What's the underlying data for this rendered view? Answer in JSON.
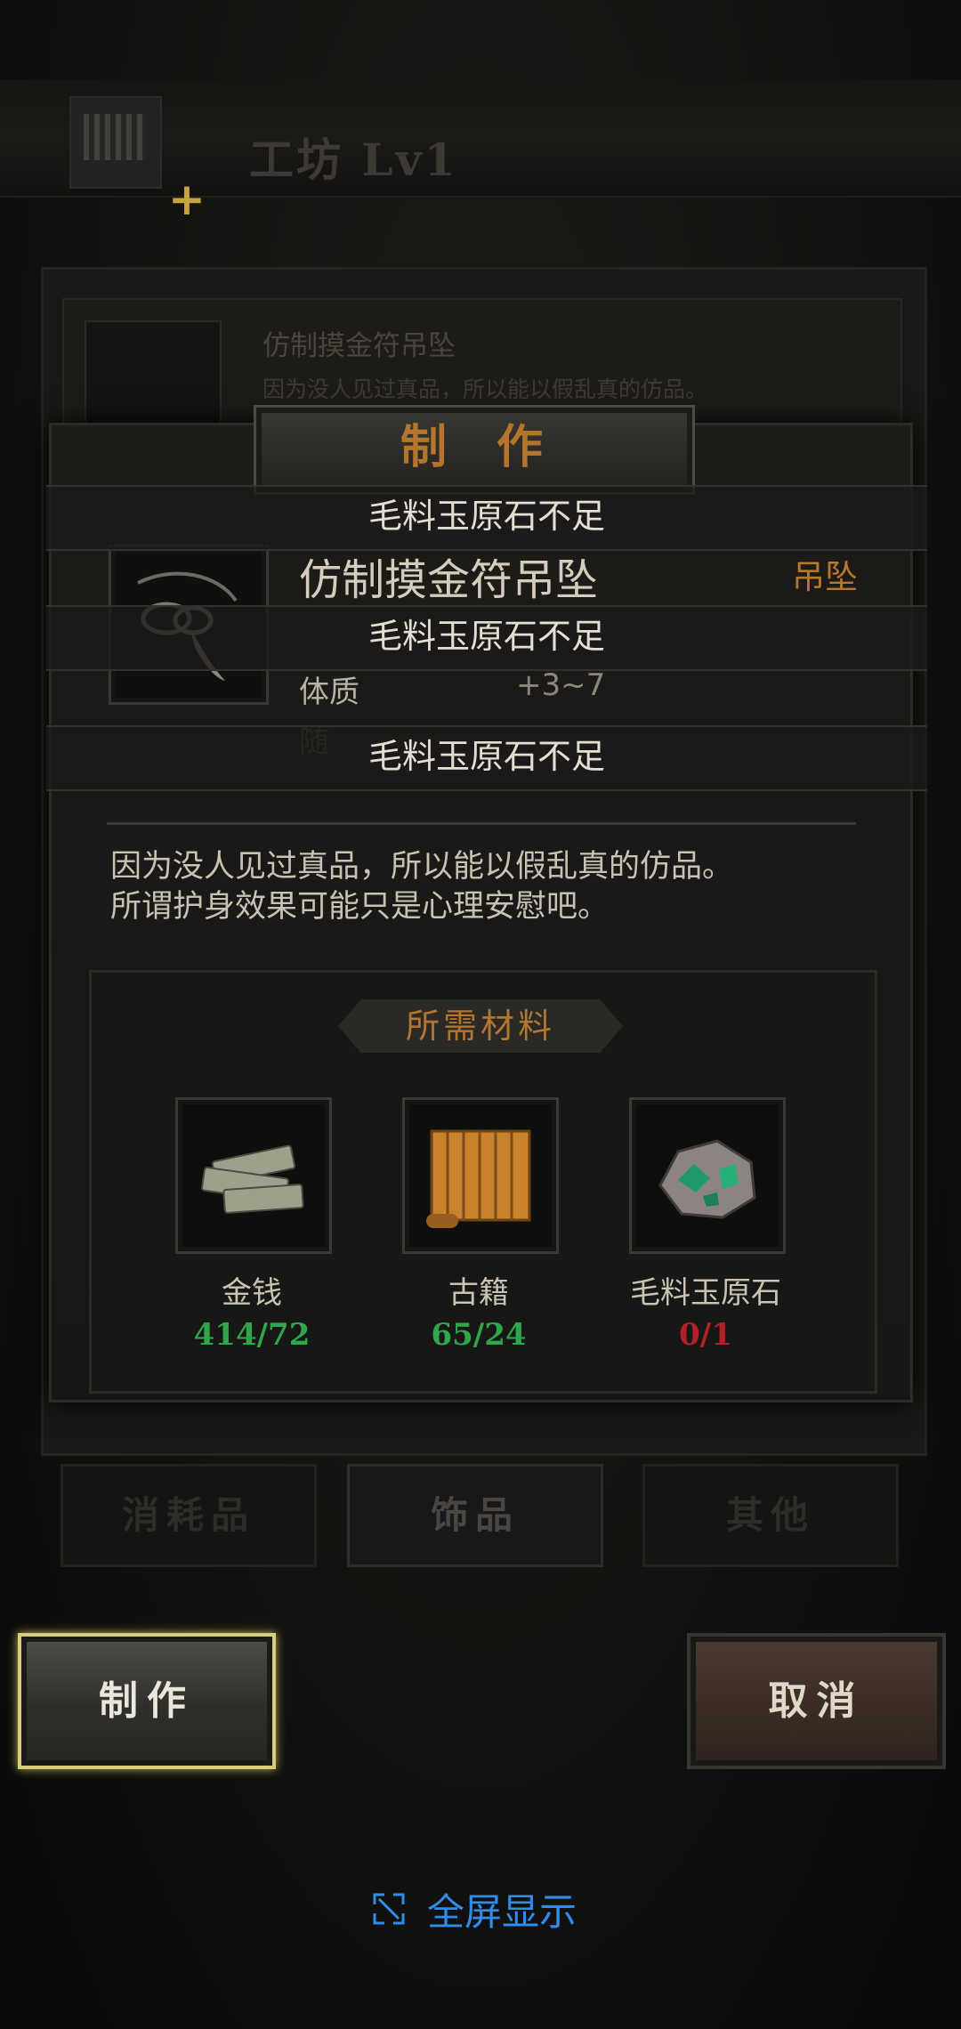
{
  "header": {
    "title": "工坊 Lv1"
  },
  "background_item": {
    "name": "仿制摸金符吊坠",
    "desc": "因为没人见过真品，所以能以假乱真的仿品。"
  },
  "tabs": [
    {
      "label": "消耗品"
    },
    {
      "label": "饰品"
    },
    {
      "label": "其他"
    }
  ],
  "dialog": {
    "title": "制作",
    "warnings": [
      "毛料玉原石不足",
      "毛料玉原石不足",
      "毛料玉原石不足"
    ],
    "item": {
      "name": "仿制摸金符吊坠",
      "type": "吊坠",
      "stat_label": "体质",
      "stat_value": "+3~7",
      "faded_label": "随"
    },
    "description": [
      "因为没人见过真品，所以能以假乱真的仿品。",
      "所谓护身效果可能只是心理安慰吧。"
    ],
    "materials_header": "所需材料",
    "materials": [
      {
        "name": "金钱",
        "count": "414/72",
        "icon": "money-stack-icon",
        "color": "#2fa64b"
      },
      {
        "name": "古籍",
        "count": "65/24",
        "icon": "ancient-scroll-icon",
        "color": "#2fa64b"
      },
      {
        "name": "毛料玉原石",
        "count": "0/1",
        "icon": "jade-ore-icon",
        "color": "#b3202a"
      }
    ]
  },
  "actions": {
    "craft_label": "制作",
    "cancel_label": "取消"
  },
  "fullscreen": {
    "label": "全屏显示",
    "icon": "expand-icon"
  },
  "colors": {
    "accent_gold": "#b3762c",
    "ok_green": "#2fa64b",
    "insufficient_red": "#b3202a",
    "link_blue": "#2f8de8"
  }
}
